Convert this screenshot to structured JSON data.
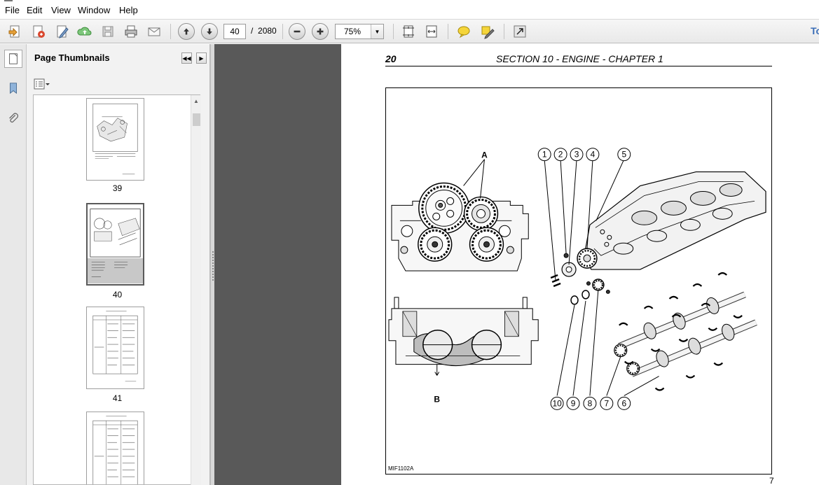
{
  "menu": [
    "File",
    "Edit",
    "View",
    "Window",
    "Help"
  ],
  "toolbar": {
    "current_page": "40",
    "page_separator": "/",
    "total_pages": "2080",
    "zoom": "75%",
    "tools_label": "To",
    "icons": [
      "create-pdf-icon",
      "convert-icon",
      "edit-icon",
      "upload-icon",
      "save-icon",
      "print-icon",
      "email-icon",
      "prev-page-icon",
      "next-page-icon",
      "zoom-out-icon",
      "zoom-in-icon",
      "fit-page-icon",
      "fit-width-icon",
      "comment-icon",
      "highlight-icon",
      "expand-icon"
    ]
  },
  "sidebar": {
    "title": "Page Thumbnails",
    "thumbnails": [
      {
        "label": "39",
        "selected": false
      },
      {
        "label": "40",
        "selected": true
      },
      {
        "label": "41",
        "selected": false
      },
      {
        "label": "",
        "selected": false
      }
    ]
  },
  "document": {
    "page_number": "20",
    "header": "SECTION 10 - ENGINE - CHAPTER 1",
    "figure_ref": "MIF1102A",
    "footer_number": "7",
    "figure_callouts_top": [
      "1",
      "2",
      "3",
      "4",
      "5"
    ],
    "figure_callouts_bottom": [
      "10",
      "9",
      "8",
      "7",
      "6"
    ],
    "figure_labels": [
      "A",
      "B"
    ]
  }
}
